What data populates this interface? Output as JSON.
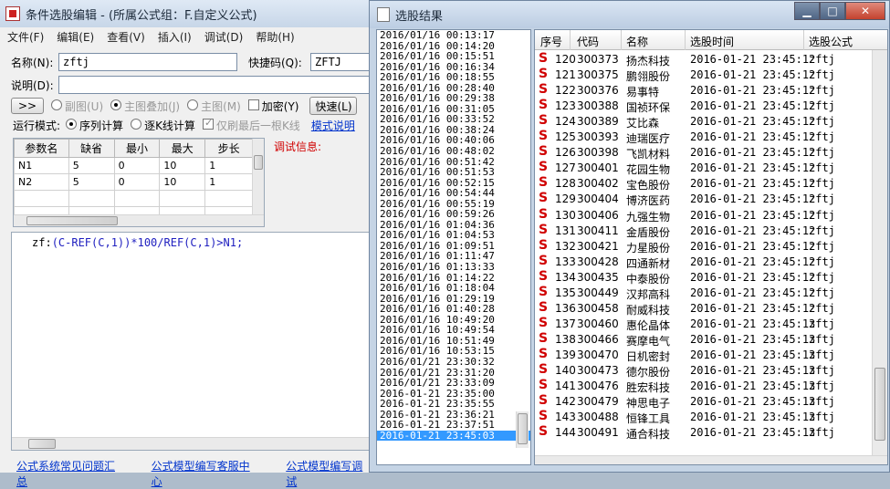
{
  "editor": {
    "title": "条件选股编辑 - (所属公式组：F.自定义公式)",
    "menu": [
      "文件(F)",
      "编辑(E)",
      "查看(V)",
      "插入(I)",
      "调试(D)",
      "帮助(H)"
    ],
    "name_label": "名称(N):",
    "name_value": "zftj",
    "shortcut_label": "快捷码(Q):",
    "shortcut_value": "ZFTJ",
    "desc_label": "说明(D):",
    "expand_btn": ">>",
    "radio_sub": "副图(U)",
    "radio_overlay": "主图叠加(J)",
    "radio_main": "主图(M)",
    "encrypt_label": "加密(Y)",
    "fast_btn": "快速(L)",
    "run_mode_label": "运行模式:",
    "run_seq": "序列计算",
    "run_kline": "逐K线计算",
    "run_last": "仅刷最后一根K线",
    "model_desc": "模式说明",
    "debug_info": "调试信息:",
    "params": {
      "headers": [
        "参数名",
        "缺省",
        "最小",
        "最大",
        "步长"
      ],
      "rows": [
        [
          "N1",
          "5",
          "0",
          "10",
          "1"
        ],
        [
          "N2",
          "5",
          "0",
          "10",
          "1"
        ]
      ]
    },
    "formula": {
      "prefix": "zf:",
      "body": "(C-REF(C,1))*100/REF(C,1)>N1;"
    },
    "footer_links": [
      "公式系统常见问题汇总",
      "公式模型编写客服中心",
      "公式模型编写调试"
    ]
  },
  "result": {
    "title": "选股结果",
    "dates": [
      "2016/01/16 00:13:17",
      "2016/01/16 00:14:20",
      "2016/01/16 00:15:51",
      "2016/01/16 00:16:34",
      "2016/01/16 00:18:55",
      "2016/01/16 00:28:40",
      "2016/01/16 00:29:38",
      "2016/01/16 00:31:05",
      "2016/01/16 00:33:52",
      "2016/01/16 00:38:24",
      "2016/01/16 00:40:06",
      "2016/01/16 00:48:02",
      "2016/01/16 00:51:42",
      "2016/01/16 00:51:53",
      "2016/01/16 00:52:15",
      "2016/01/16 00:54:44",
      "2016/01/16 00:55:19",
      "2016/01/16 00:59:26",
      "2016/01/16 01:04:36",
      "2016/01/16 01:04:53",
      "2016/01/16 01:09:51",
      "2016/01/16 01:11:47",
      "2016/01/16 01:13:33",
      "2016/01/16 01:14:22",
      "2016/01/16 01:18:04",
      "2016/01/16 01:29:19",
      "2016/01/16 01:40:28",
      "2016/01/16 10:49:20",
      "2016/01/16 10:49:54",
      "2016/01/16 10:51:49",
      "2016/01/16 10:53:15",
      "2016/01/21 23:30:32",
      "2016/01/21 23:31:20",
      "2016/01/21 23:33:09",
      "2016-01-21 23:35:00",
      "2016-01-21 23:35:55",
      "2016-01-21 23:36:21",
      "2016-01-21 23:37:51",
      "2016-01-21 23:45:03"
    ],
    "selected_date_index": 38,
    "columns": [
      "序号",
      "代码",
      "名称",
      "选股时间",
      "选股公式"
    ],
    "rows": [
      [
        "120",
        "300373",
        "扬杰科技",
        "2016-01-21 23:45:12",
        "zftj"
      ],
      [
        "121",
        "300375",
        "鹏翎股份",
        "2016-01-21 23:45:12",
        "zftj"
      ],
      [
        "122",
        "300376",
        "易事特",
        "2016-01-21 23:45:12",
        "zftj"
      ],
      [
        "123",
        "300388",
        "国祯环保",
        "2016-01-21 23:45:12",
        "zftj"
      ],
      [
        "124",
        "300389",
        "艾比森",
        "2016-01-21 23:45:12",
        "zftj"
      ],
      [
        "125",
        "300393",
        "迪瑞医疗",
        "2016-01-21 23:45:12",
        "zftj"
      ],
      [
        "126",
        "300398",
        "飞凯材料",
        "2016-01-21 23:45:12",
        "zftj"
      ],
      [
        "127",
        "300401",
        "花园生物",
        "2016-01-21 23:45:12",
        "zftj"
      ],
      [
        "128",
        "300402",
        "宝色股份",
        "2016-01-21 23:45:12",
        "zftj"
      ],
      [
        "129",
        "300404",
        "博济医药",
        "2016-01-21 23:45:12",
        "zftj"
      ],
      [
        "130",
        "300406",
        "九强生物",
        "2016-01-21 23:45:12",
        "zftj"
      ],
      [
        "131",
        "300411",
        "金盾股份",
        "2016-01-21 23:45:12",
        "zftj"
      ],
      [
        "132",
        "300421",
        "力星股份",
        "2016-01-21 23:45:12",
        "zftj"
      ],
      [
        "133",
        "300428",
        "四通新材",
        "2016-01-21 23:45:12",
        "zftj"
      ],
      [
        "134",
        "300435",
        "中泰股份",
        "2016-01-21 23:45:12",
        "zftj"
      ],
      [
        "135",
        "300449",
        "汉邦高科",
        "2016-01-21 23:45:12",
        "zftj"
      ],
      [
        "136",
        "300458",
        "耐威科技",
        "2016-01-21 23:45:12",
        "zftj"
      ],
      [
        "137",
        "300460",
        "惠伦晶体",
        "2016-01-21 23:45:13",
        "zftj"
      ],
      [
        "138",
        "300466",
        "赛摩电气",
        "2016-01-21 23:45:13",
        "zftj"
      ],
      [
        "139",
        "300470",
        "日机密封",
        "2016-01-21 23:45:13",
        "zftj"
      ],
      [
        "140",
        "300473",
        "德尔股份",
        "2016-01-21 23:45:13",
        "zftj"
      ],
      [
        "141",
        "300476",
        "胜宏科技",
        "2016-01-21 23:45:13",
        "zftj"
      ],
      [
        "142",
        "300479",
        "神思电子",
        "2016-01-21 23:45:13",
        "zftj"
      ],
      [
        "143",
        "300488",
        "恒锋工具",
        "2016-01-21 23:45:13",
        "zftj"
      ],
      [
        "144",
        "300491",
        "通合科技",
        "2016-01-21 23:45:13",
        "zftj"
      ]
    ],
    "row_marker": "S"
  }
}
